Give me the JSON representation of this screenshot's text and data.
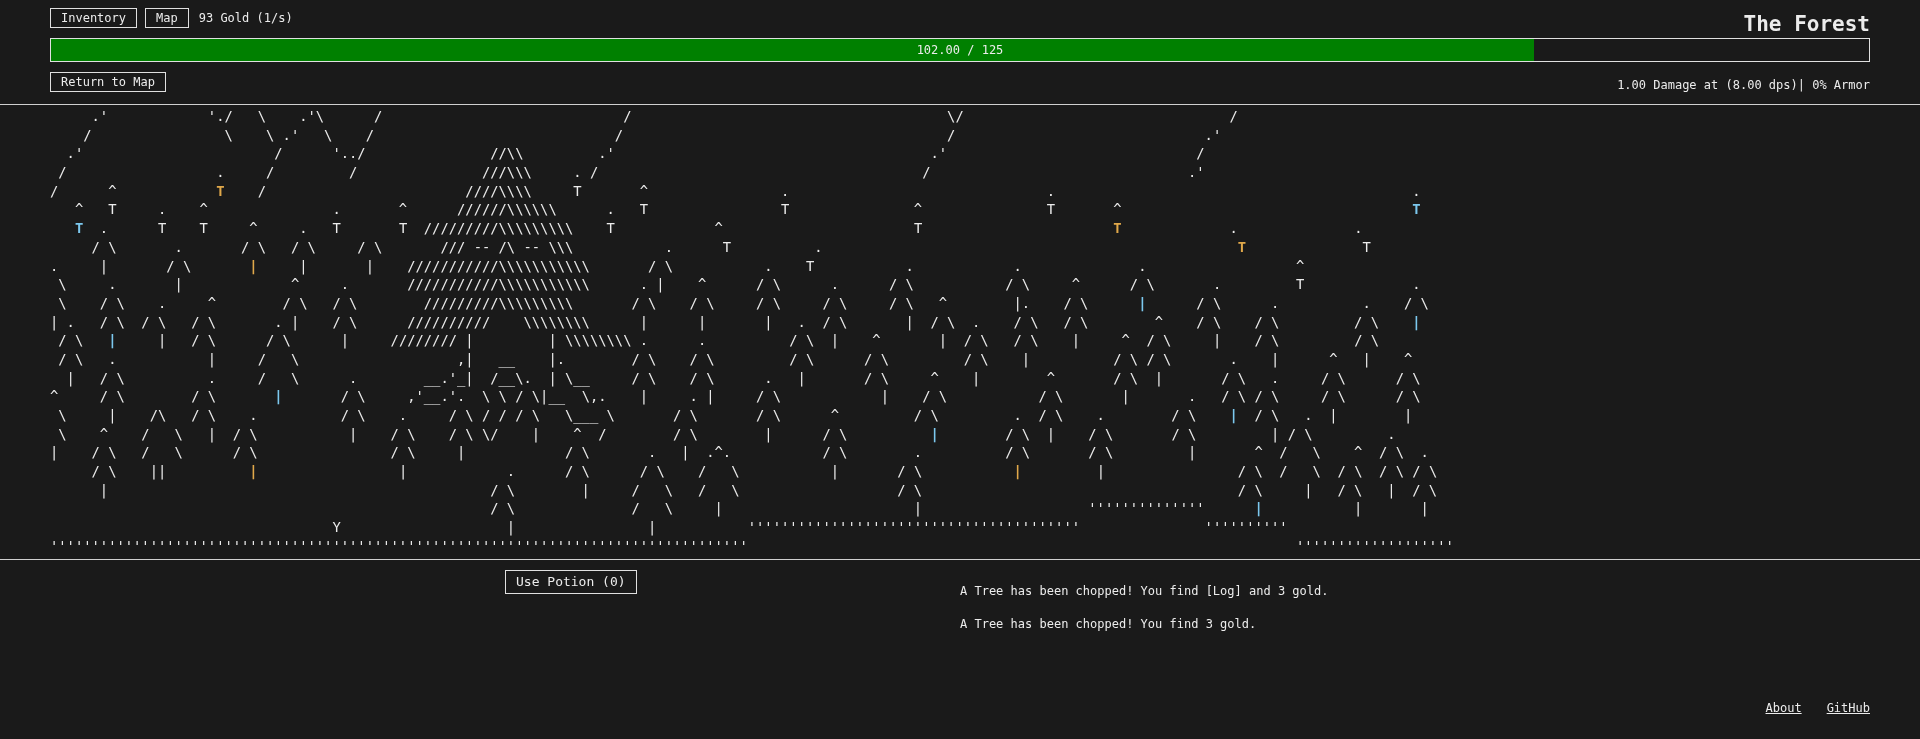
{
  "toolbar": {
    "buttons": [
      "Inventory",
      "Map"
    ],
    "gold": "93 Gold (1/s)"
  },
  "title": "The Forest",
  "health_bar": {
    "label": "102.00 / 125",
    "level": 0.816
  },
  "return_button": "Return to Map",
  "stats": "1.00 Damage at (8.00 dps)| 0% Armor",
  "scene": {
    "lines": [
      {
        "parts": [
          "     .'            './   \\    .'\\      /                             /                                      \\/                                /"
        ]
      },
      {
        "parts": [
          "    /                \\    \\ .'   \\    /                             /                                       /                              .'"
        ]
      },
      {
        "parts": [
          "  .'                       /      '../               //\\\\         .'                                      .'                              /"
        ]
      },
      {
        "parts": [
          " /                  .     /         /               ///\\\\\\     . /                                       /                               .'"
        ]
      },
      {
        "parts": [
          "/      ^            ",
          {
            "text": "T",
            "color": "#e0a84a"
          },
          "    /                        ////\\\\\\\\     T       ^                .                               .                                           ."
        ]
      },
      {
        "parts": [
          "   ^   T     .    ^               .       ^      //////\\\\\\\\\\\\      .   T                T               ^               T       ^                                   ",
          {
            "text": "T",
            "color": "#7cc8ee"
          }
        ]
      },
      {
        "parts": [
          {
            "text": "   T",
            "color": "#7cc8ee"
          },
          "  .      T    T     ^     .   T       T  /////////\\\\\\\\\\\\\\\\\\    T            ^                       T                       ",
          {
            "text": "T",
            "color": "#e0a84a"
          },
          "             .              ."
        ]
      },
      {
        "parts": [
          "     / \\       .       / \\   / \\     / \\       /// -- /\\ -- \\\\\\           .      T          .                                                  ",
          {
            "text": "T",
            "color": "#e0a84a"
          },
          "              T"
        ]
      },
      {
        "parts": [
          ".     |       / \\       ",
          {
            "text": "|",
            "color": "#e0a84a"
          },
          "     |       |    ///////////\\\\\\\\\\\\\\\\\\\\\\       / \\           .    T           .            .              .                  ^"
        ]
      },
      {
        "parts": [
          " \\     .       |             ^     .       ///////////\\\\\\\\\\\\\\\\\\\\\\      . |    ^      / \\      .      / \\           / \\     ^      / \\       .         T             ."
        ]
      },
      {
        "parts": [
          " \\    / \\    .     ^        / \\   / \\        /////////\\\\\\\\\\\\\\\\\\       / \\    / \\     / \\     / \\     / \\   ^        |.    / \\      ",
          {
            "text": "|",
            "color": "#7cc8ee"
          },
          "      / \\      .          .    / \\"
        ]
      },
      {
        "parts": [
          "| .   / \\  / \\   / \\       . |    / \\      //////////    \\\\\\\\\\\\\\\\      |      |       |   .  / \\       |  / \\  .    / \\   / \\        ^    / \\    / \\         / \\    ",
          {
            "text": "|",
            "color": "#7cc8ee"
          }
        ]
      },
      {
        "parts": [
          " / \\   ",
          {
            "text": "|",
            "color": "#7cc8ee"
          },
          "     |   / \\      / \\      |     //////// |         | \\\\\\\\\\\\\\\\ .      .          / \\  |    ^       |  / \\   / \\    |     ^  / \\     |    / \\         / \\"
        ]
      },
      {
        "parts": [
          " / \\   .           |     /   \\                   ,|   __    |.        / \\    / \\         / \\      / \\         / \\    |          / \\ / \\       .    |      ^   |    ^"
        ]
      },
      {
        "parts": [
          "  |   / \\          .     /   \\      .        __.'_|  /__\\.  | \\__     / \\    / \\      .   |       / \\     ^    |        ^       / \\  |       / \\   .     / \\      / \\"
        ]
      },
      {
        "parts": [
          "^     / \\        / \\       ",
          {
            "text": "|",
            "color": "#7cc8ee"
          },
          "       / \\     ,'__.'.  \\ \\ / \\|__  \\,.    |     . |     / \\            |    / \\           / \\       |       .   / \\ / \\     / \\      / \\"
        ]
      },
      {
        "parts": [
          " \\     |    /\\   / \\    .          / \\    .     / \\ / / / \\   \\___ \\       / \\       / \\      ^         / \\         .  / \\    .        / \\    ",
          {
            "text": "|",
            "color": "#7cc8ee"
          },
          "  / \\   .  |        |"
        ]
      },
      {
        "parts": [
          " \\    ^    /   \\   |  / \\           |    / \\    / \\ \\/    |    ^  /        / \\        |      / \\          ",
          {
            "text": "|",
            "color": "#7cc8ee"
          },
          "        / \\  |    / \\       / \\         | / \\         ."
        ]
      },
      {
        "parts": [
          "|    / \\   /   \\      / \\                / \\     |            / \\       .   |  .^.           / \\        .          / \\       / \\         |       ^  /   \\    ^  / \\  ."
        ]
      },
      {
        "parts": [
          "     / \\    ||          ",
          {
            "text": "|",
            "color": "#e0a84a"
          },
          "                 |            .      / \\      / \\    /   \\           |       / \\           ",
          {
            "text": "|",
            "color": "#e0a84a"
          },
          "         |                / \\  /   \\  / \\  / \\ / \\"
        ]
      },
      {
        "parts": [
          "      |                                              / \\        |     /   \\   /   \\                   / \\                                      / \\     |   / \\   |  / \\"
        ]
      },
      {
        "parts": [
          "                                                     / \\              /   \\     |                       |                    ''''''''''''''      ",
          {
            "text": "|",
            "color": "#7cc8ee"
          },
          "           |       |"
        ]
      },
      {
        "parts": [
          "                                  Y                    |                |           ''''''''''''''''''''''''''''''''''''''''               ''''''''''"
        ]
      },
      {
        "parts": [
          "''''''''''''''''''''''''''''''''''''''''''''''''''''''''''''''''''''''''''''''''''''                                                                  '''''''''''''''''''"
        ]
      }
    ]
  },
  "potion_button": "Use Potion (0)",
  "log": [
    "A Tree has been chopped! You find [Log] and 3 gold.",
    "A Tree has been chopped! You find 3 gold."
  ],
  "footer_links": [
    "About",
    "GitHub"
  ]
}
